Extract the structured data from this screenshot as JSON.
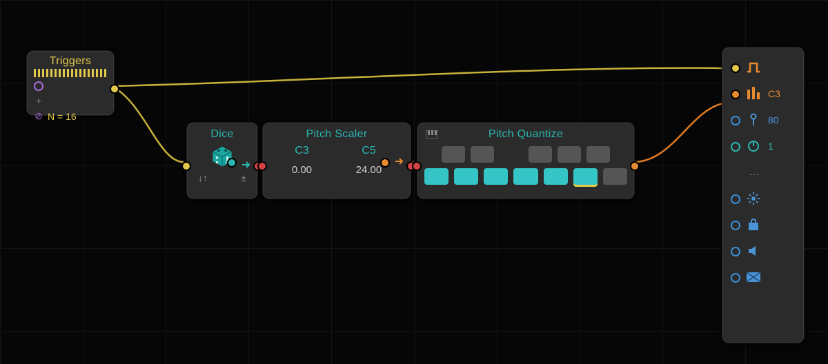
{
  "triggers": {
    "title": "Triggers",
    "n_label": "N = 16",
    "plus": "+",
    "slash_icon": "⊘"
  },
  "dice": {
    "title": "Dice",
    "sort_icon": "↓↑",
    "plus_icon": "±"
  },
  "scaler": {
    "title": "Pitch Scaler",
    "low_note": "C3",
    "high_note": "C5",
    "low_val": "0.00",
    "high_val": "24.00"
  },
  "quant": {
    "title": "Pitch Quantize",
    "top": [
      "on",
      "on",
      "sp",
      "on",
      "on",
      "on"
    ],
    "bottom": [
      "on",
      "on",
      "on",
      "on",
      "on",
      "sel",
      "off"
    ]
  },
  "outputs": {
    "gate_icon": "gate",
    "pitch_label": "C3",
    "vel_label": "80",
    "dur_label": "1",
    "more": "…"
  }
}
